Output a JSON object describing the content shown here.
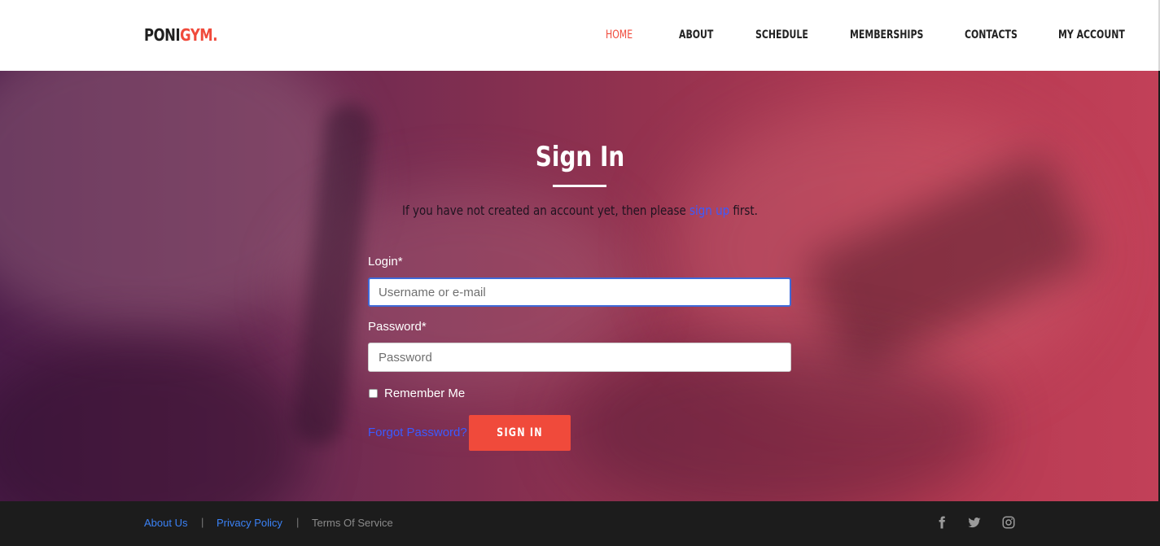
{
  "header": {
    "logo_primary": "PONI",
    "logo_accent": "GYM.",
    "nav": [
      "HOME",
      "ABOUT",
      "SCHEDULE",
      "MEMBERSHIPS",
      "CONTACTS",
      "MY ACCOUNT"
    ],
    "active_item": "HOME"
  },
  "hero": {
    "title": "Sign In",
    "subtitle_before": "If you have not created an account yet, then please ",
    "subtitle_link": "sign up",
    "subtitle_after": " first."
  },
  "form": {
    "login_label": "Login*",
    "login_placeholder": "Username or e-mail",
    "password_label": "Password*",
    "password_placeholder": "Password",
    "remember_label": "Remember Me",
    "remember_checked": false,
    "forgot_label": "Forgot Password?",
    "submit_label": "SIGN IN"
  },
  "footer": {
    "about_label": "About Us",
    "separator": "|",
    "privacy_label": "Privacy Policy",
    "terms_label": "Terms Of Service",
    "social_icons": [
      "facebook-icon",
      "twitter-icon",
      "instagram-icon"
    ]
  },
  "colors": {
    "accent": "#f04a3b",
    "link": "#3b5bff",
    "footer_bg": "#1c1c1c"
  }
}
